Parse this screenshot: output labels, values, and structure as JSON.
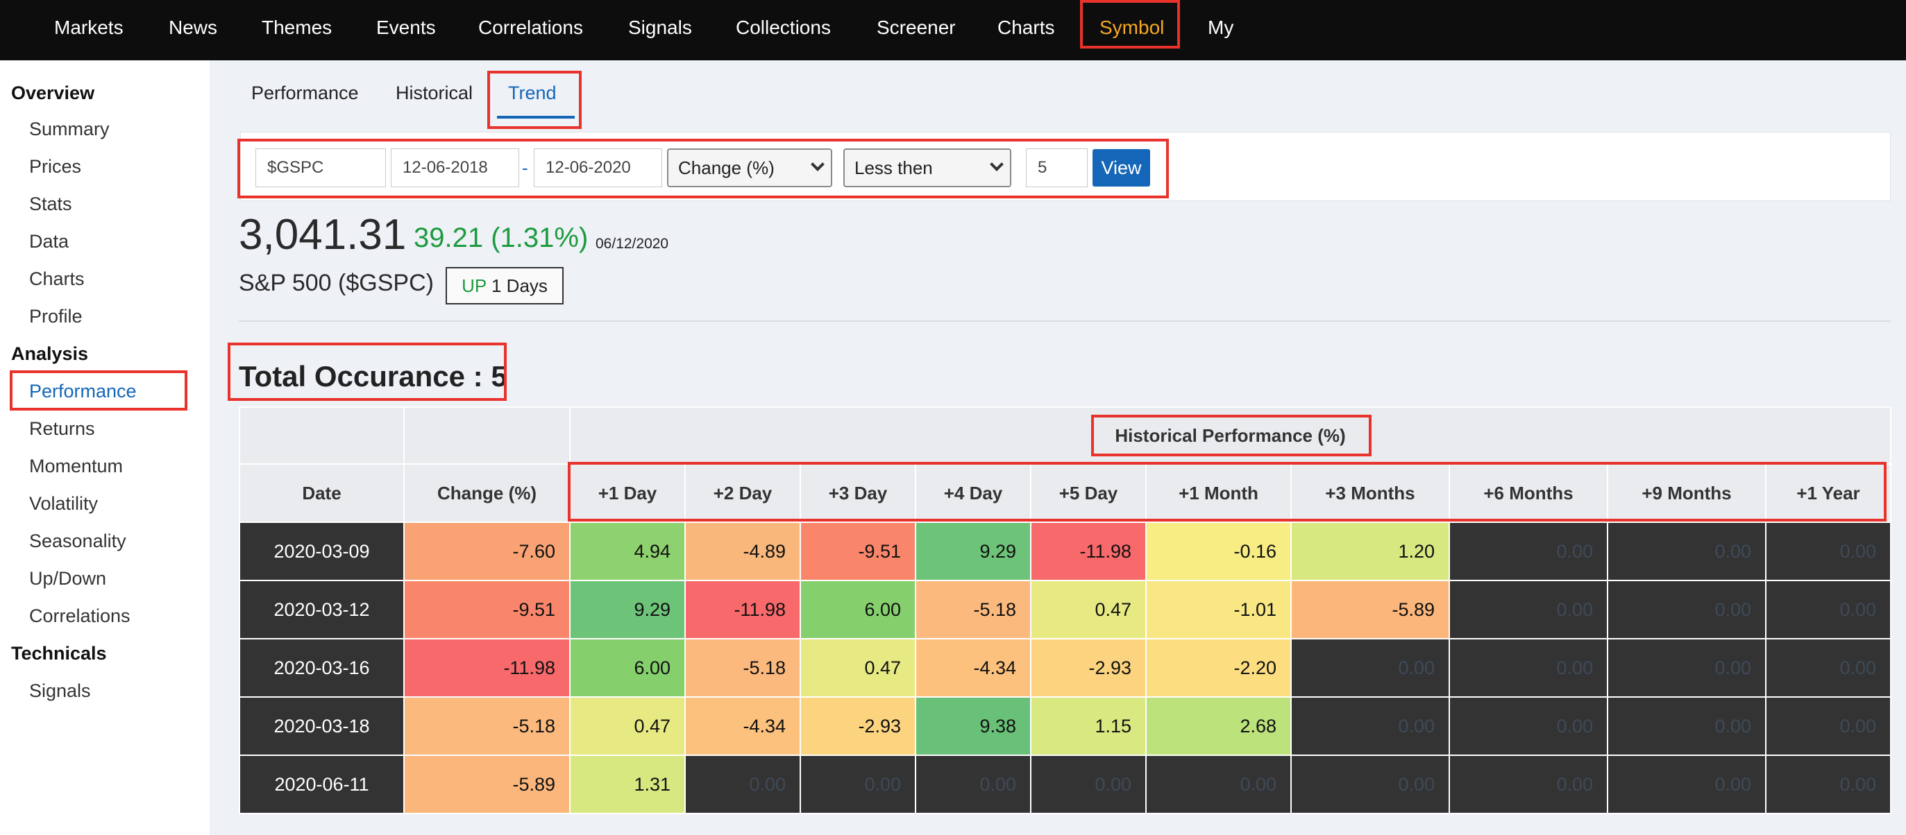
{
  "nav": {
    "items": [
      "Markets",
      "News",
      "Themes",
      "Events",
      "Correlations",
      "Signals",
      "Collections",
      "Screener",
      "Charts",
      "Symbol",
      "My"
    ],
    "active": "Symbol"
  },
  "sidebar": {
    "overview_heading": "Overview",
    "overview_items": [
      "Summary",
      "Prices",
      "Stats",
      "Data",
      "Charts",
      "Profile"
    ],
    "analysis_heading": "Analysis",
    "analysis_items": [
      "Performance",
      "Returns",
      "Momentum",
      "Volatility",
      "Seasonality",
      "Up/Down",
      "Correlations"
    ],
    "technicals_heading": "Technicals",
    "technicals_items": [
      "Signals"
    ],
    "active": "Performance"
  },
  "tabs": {
    "items": [
      "Performance",
      "Historical",
      "Trend"
    ],
    "active": "Trend"
  },
  "filters": {
    "symbol": "$GSPC",
    "start_date": "12-06-2018",
    "separator": "-",
    "end_date": "12-06-2020",
    "metric": "Change (%)",
    "condition": "Less then",
    "threshold": "5",
    "view_label": "View"
  },
  "quote": {
    "price": "3,041.31",
    "change": "39.21 (1.31%)",
    "date": "06/12/2020",
    "name": "S&P 500 ($GSPC)",
    "trend_dir": "UP",
    "trend_len": "1 Days"
  },
  "occurrence": "Total Occurance : 5",
  "table": {
    "group_header": "Historical Performance (%)",
    "columns": [
      "Date",
      "Change (%)",
      "+1 Day",
      "+2 Day",
      "+3 Day",
      "+4 Day",
      "+5 Day",
      "+1 Month",
      "+3 Months",
      "+6 Months",
      "+9 Months",
      "+1 Year"
    ],
    "rows": [
      {
        "date": "2020-03-09",
        "values": [
          "-7.60",
          "4.94",
          "-4.89",
          "-9.51",
          "9.29",
          "-11.98",
          "-0.16",
          "1.20",
          "0.00",
          "0.00",
          "0.00"
        ],
        "colors": [
          "#f9a273",
          "#8ed26f",
          "#fab77c",
          "#f9866b",
          "#6dc378",
          "#f8696b",
          "#f7ed83",
          "#d8e881",
          null,
          null,
          null
        ]
      },
      {
        "date": "2020-03-12",
        "values": [
          "-9.51",
          "9.29",
          "-11.98",
          "6.00",
          "-5.18",
          "0.47",
          "-1.01",
          "-5.89",
          null,
          null,
          null
        ],
        "colors": [
          "#f9866b",
          "#6dc378",
          "#f8696b",
          "#86cf6d",
          "#fbb97d",
          "#e7ea82",
          "#f9e784",
          "#fbb67b",
          null,
          null,
          null
        ]
      },
      {
        "date": "2020-03-16",
        "values": [
          "-11.98",
          "6.00",
          "-5.18",
          "0.47",
          "-4.34",
          "-2.93",
          "-2.20",
          null,
          null,
          null,
          null
        ],
        "colors": [
          "#f8696b",
          "#86cf6d",
          "#fbb97d",
          "#e7ea82",
          "#fcc27d",
          "#fcd47f",
          "#fcde81",
          null,
          null,
          null,
          null
        ]
      },
      {
        "date": "2020-03-18",
        "values": [
          "-5.18",
          "0.47",
          "-4.34",
          "-2.93",
          "9.38",
          "1.15",
          "2.68",
          null,
          null,
          null,
          null
        ],
        "colors": [
          "#fbb97d",
          "#e7ea82",
          "#fcc27d",
          "#fcd47f",
          "#69c078",
          "#d9e881",
          "#bce27b",
          null,
          null,
          null,
          null
        ]
      },
      {
        "date": "2020-06-11",
        "values": [
          "-5.89",
          "1.31",
          null,
          null,
          null,
          null,
          null,
          null,
          null,
          null,
          null
        ],
        "colors": [
          "#fbb67b",
          "#d7e881",
          null,
          null,
          null,
          null,
          null,
          null,
          null,
          null,
          null
        ]
      }
    ],
    "na_value": "0.00"
  }
}
